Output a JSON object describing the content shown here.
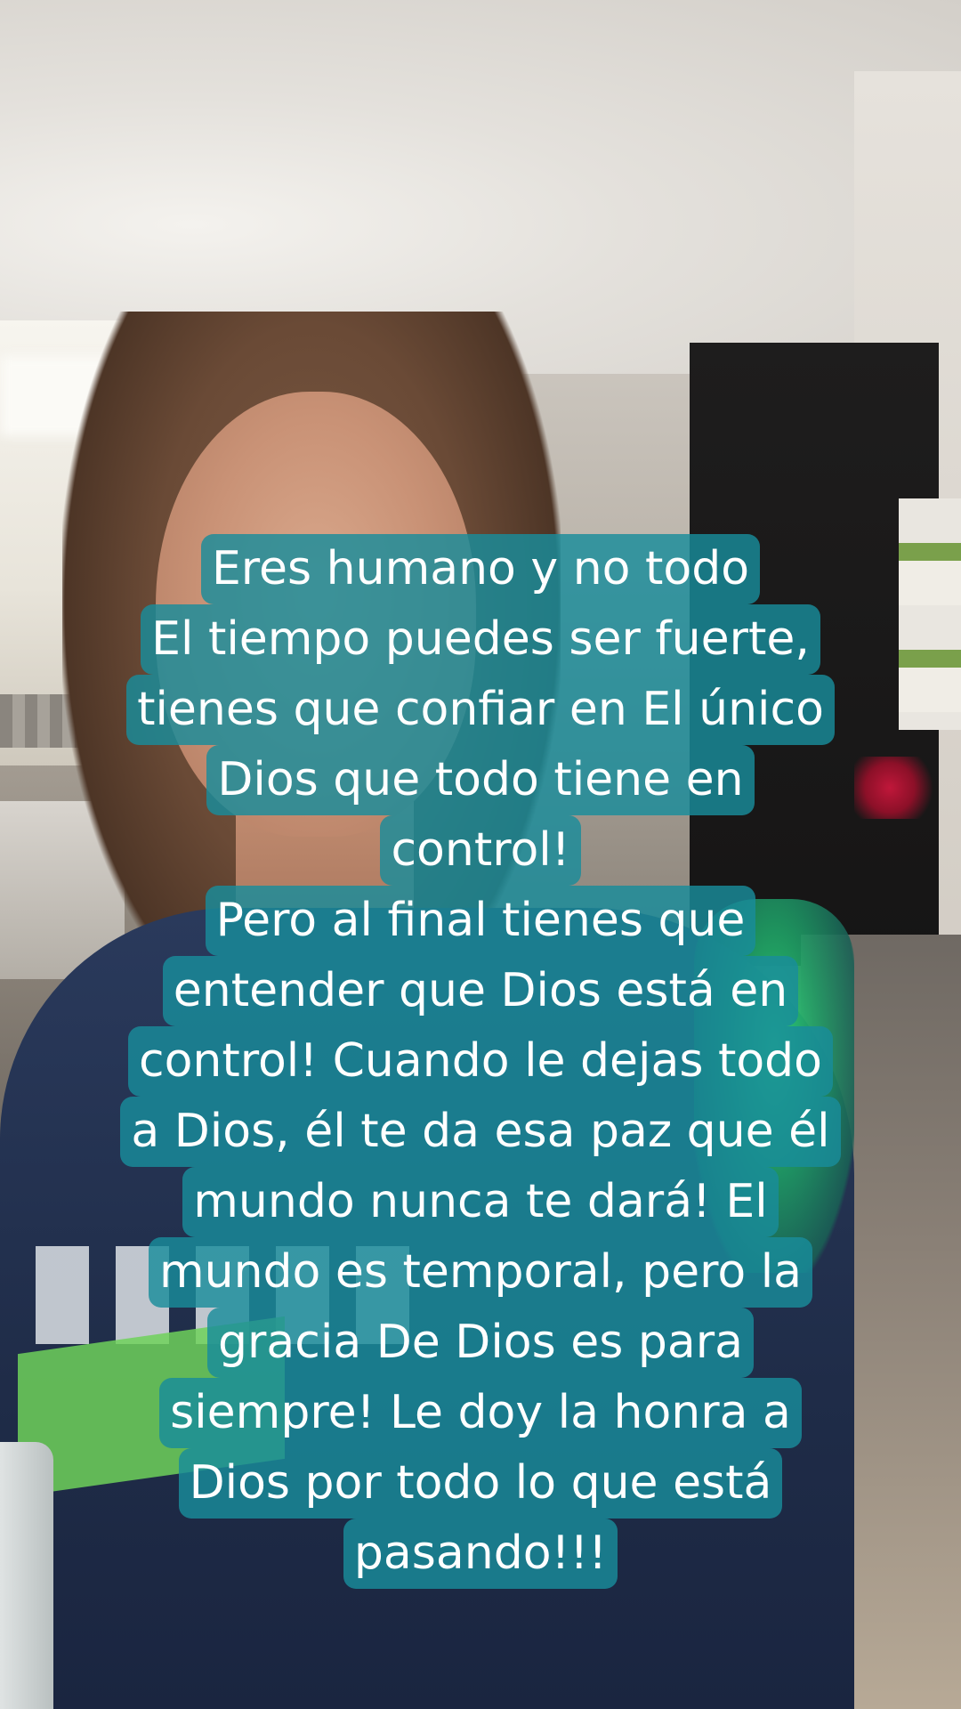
{
  "caption": {
    "lines": [
      "Eres humano y no todo",
      "El tiempo puedes ser fuerte,",
      "tienes que confiar en El único",
      "Dios que todo tiene en",
      "control!",
      "Pero al final tienes que",
      "entender que Dios está en",
      "control! Cuando le dejas todo",
      "a Dios, él te da esa paz que él",
      "mundo nunca te dará! El",
      "mundo es temporal, pero la",
      "gracia De Dios es para",
      "siempre! Le doy la honra a",
      "Dios por todo lo que está",
      "pasando!!!"
    ]
  },
  "colors": {
    "caption_background": "#198c9b",
    "caption_text": "#ffffff"
  }
}
